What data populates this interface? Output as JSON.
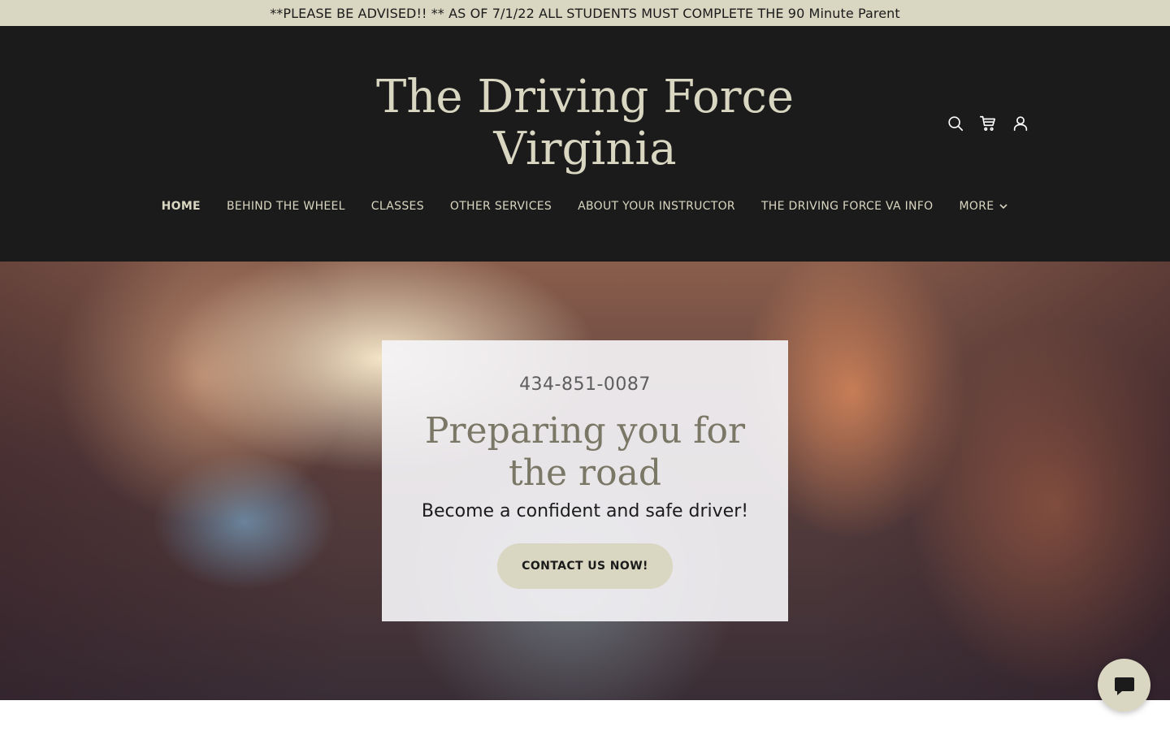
{
  "announcement": {
    "text": "**PLEASE BE ADVISED!! ** AS OF 7/1/22 ALL STUDENTS MUST COMPLETE THE 90 Minute Parent"
  },
  "header": {
    "title_line1": "The Driving Force",
    "title_line2": "Virginia",
    "icons": [
      "search-icon",
      "cart-icon",
      "account-icon"
    ]
  },
  "nav": {
    "items": [
      {
        "label": "HOME",
        "active": true
      },
      {
        "label": "BEHIND THE WHEEL"
      },
      {
        "label": "CLASSES"
      },
      {
        "label": "OTHER SERVICES"
      },
      {
        "label": "ABOUT YOUR INSTRUCTOR"
      },
      {
        "label": "THE DRIVING FORCE VA INFO"
      },
      {
        "label": "MORE"
      }
    ]
  },
  "hero": {
    "phone": "434-851-0087",
    "title_line1": "Preparing you for",
    "title_line2": "the road",
    "subtitle": "Become a confident and safe driver!",
    "cta_label": "CONTACT US NOW!"
  },
  "chat": {
    "icon": "chat-bubble-icon"
  },
  "colors": {
    "header_bg": "#1b1b1b",
    "accent": "#d9d6c1",
    "hero_title": "#7a7766",
    "card_bg": "#f4f3f6"
  }
}
